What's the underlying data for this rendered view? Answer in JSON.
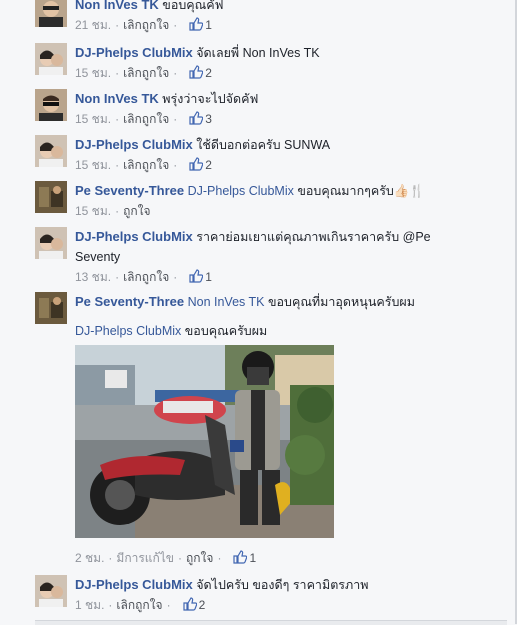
{
  "comments": [
    {
      "author": "Non InVes TK",
      "mention": "",
      "text": "ขอบคุณคัฟ",
      "time": "21 ชม.",
      "action": "เลิกถูกใจ",
      "likes": "1",
      "edited": ""
    },
    {
      "author": "DJ-Phelps ClubMix",
      "mention": "",
      "text": "จัดเลยพี่ Non InVes TK",
      "time": "15 ชม.",
      "action": "เลิกถูกใจ",
      "likes": "2",
      "edited": ""
    },
    {
      "author": "Non InVes TK",
      "mention": "",
      "text": "พรุ่งว่าจะไปจัดคัฟ",
      "time": "15 ชม.",
      "action": "เลิกถูกใจ",
      "likes": "3",
      "edited": ""
    },
    {
      "author": "DJ-Phelps ClubMix",
      "mention": "",
      "text": "ใช้ดีบอกต่อครับ SUNWA",
      "time": "15 ชม.",
      "action": "เลิกถูกใจ",
      "likes": "2",
      "edited": ""
    },
    {
      "author": "Pe Seventy-Three",
      "mention": "DJ-Phelps ClubMix",
      "text": "ขอบคุณมากๆครับ👍🏻🍴",
      "time": "15 ชม.",
      "action": "ถูกใจ",
      "likes": "",
      "edited": ""
    },
    {
      "author": "DJ-Phelps ClubMix",
      "mention": "",
      "text": "ราคาย่อมเยาแต่คุณภาพเกินราคาครับ @Pe",
      "text2": "Seventy",
      "time": "13 ชม.",
      "action": "เลิกถูกใจ",
      "likes": "1",
      "edited": ""
    },
    {
      "author": "Pe Seventy-Three",
      "mention": "Non InVes TK",
      "text": "ขอบคุณที่มาอุดหนุนครับผม",
      "mention2": "DJ-Phelps ClubMix",
      "text2": "ขอบคุณครับผม",
      "time": "2 ชม.",
      "action": "ถูกใจ",
      "likes": "1",
      "edited": "มีการแก้ไข"
    },
    {
      "author": "DJ-Phelps ClubMix",
      "mention": "",
      "text": "จัดไปครับ ของดีๆ ราคามิตรภาพ",
      "time": "1 ชม.",
      "action": "เลิกถูกใจ",
      "likes": "2",
      "edited": ""
    }
  ],
  "colors": {
    "link": "#365899",
    "meta": "#90949c",
    "background": "#f6f7f9"
  }
}
